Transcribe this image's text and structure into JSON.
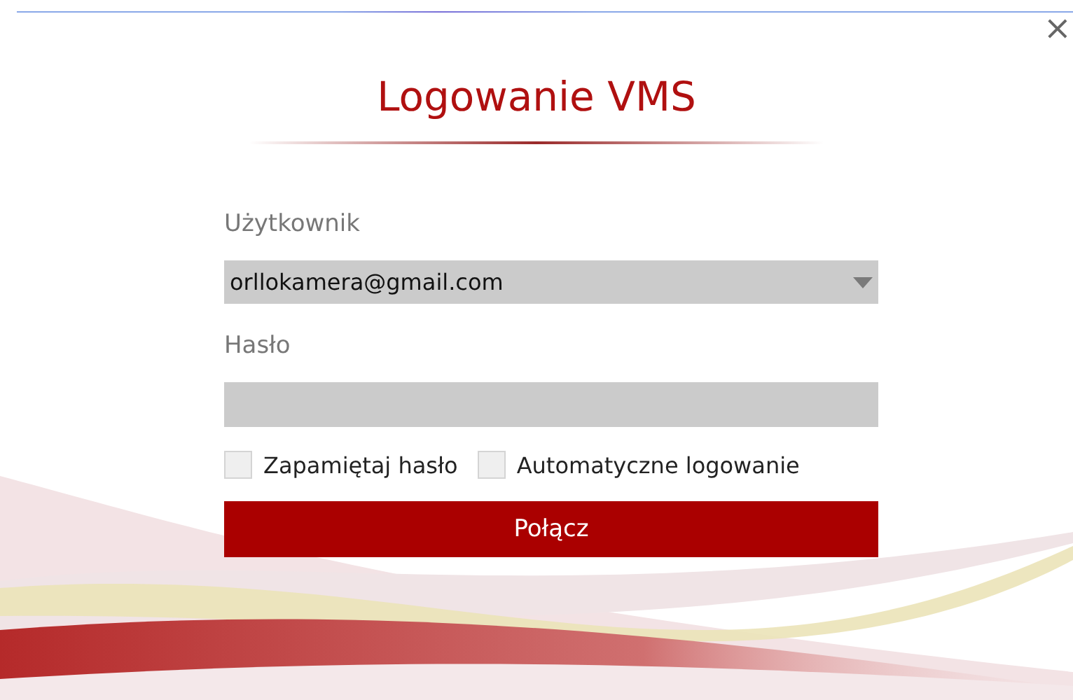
{
  "dialog": {
    "title": "Logowanie VMS",
    "close": "×"
  },
  "form": {
    "user_label": "Użytkownik",
    "user_value": "orllokamera@gmail.com",
    "password_label": "Hasło",
    "options": [
      {
        "label": "Zapamiętaj hasło",
        "checked": false
      },
      {
        "label": "Automatyczne logowanie",
        "checked": false
      }
    ],
    "submit": "Połącz"
  }
}
